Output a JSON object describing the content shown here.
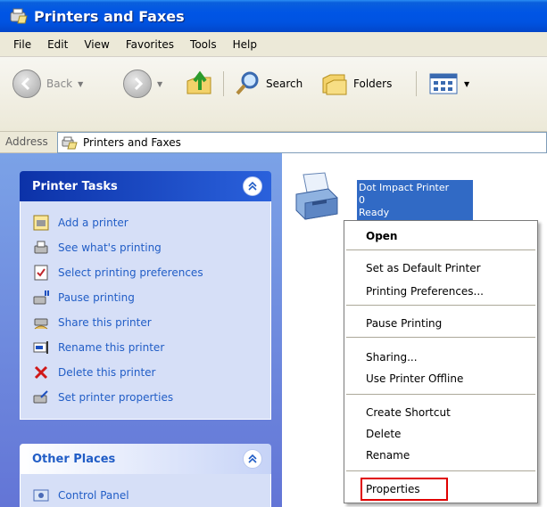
{
  "window": {
    "title": "Printers and Faxes"
  },
  "menubar": [
    "File",
    "Edit",
    "View",
    "Favorites",
    "Tools",
    "Help"
  ],
  "toolbar": {
    "back_label": "Back",
    "search_label": "Search",
    "folders_label": "Folders"
  },
  "address": {
    "label": "Address",
    "value": "Printers and Faxes"
  },
  "printer_tasks": {
    "title": "Printer Tasks",
    "items": [
      {
        "label": "Add a printer",
        "icon": "add-printer-icon"
      },
      {
        "label": "See what's printing",
        "icon": "print-queue-icon"
      },
      {
        "label": "Select printing preferences",
        "icon": "preferences-icon"
      },
      {
        "label": "Pause printing",
        "icon": "pause-printer-icon"
      },
      {
        "label": "Share this printer",
        "icon": "share-printer-icon"
      },
      {
        "label": "Rename this printer",
        "icon": "rename-icon"
      },
      {
        "label": "Delete this printer",
        "icon": "delete-x-icon"
      },
      {
        "label": "Set printer properties",
        "icon": "printer-properties-icon"
      }
    ]
  },
  "other_places": {
    "title": "Other Places",
    "items": [
      {
        "label": "Control Panel",
        "icon": "control-panel-icon"
      }
    ]
  },
  "printer": {
    "name": "Dot Impact Printer",
    "jobs": "0",
    "status": "Ready"
  },
  "context_menu": {
    "items": [
      "Open",
      "Set as Default Printer",
      "Printing Preferences...",
      "Pause Printing",
      "Sharing...",
      "Use Printer Offline",
      "Create Shortcut",
      "Delete",
      "Rename",
      "Properties"
    ]
  },
  "colors": {
    "title_bar": "#0055e5",
    "task_pane": "#7ba2e7",
    "link": "#215dc6",
    "selection": "#316ac5",
    "highlight_box": "#e00000"
  }
}
